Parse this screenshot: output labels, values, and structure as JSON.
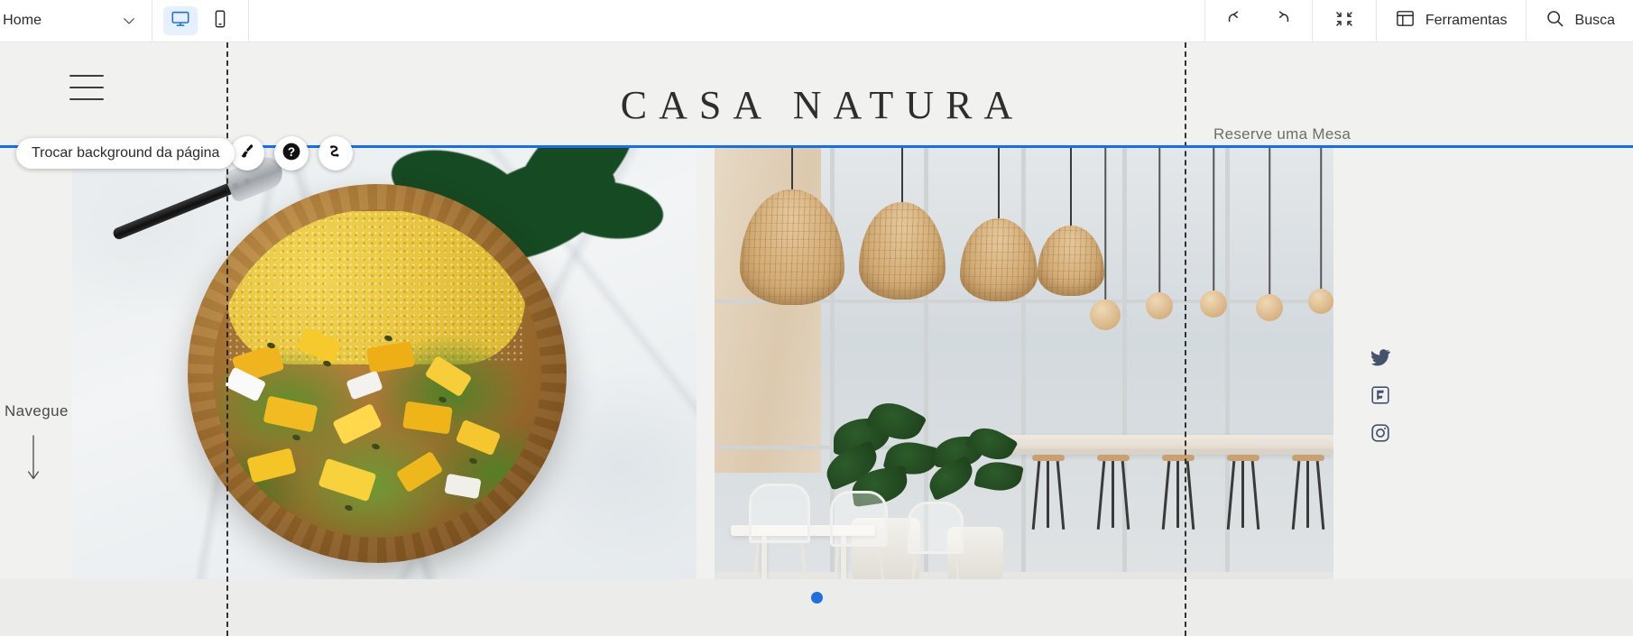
{
  "editor": {
    "page_selector": {
      "label": ": Home",
      "chevron_icon": "chevron-down-icon"
    },
    "devices": [
      {
        "name": "desktop",
        "icon": "monitor-icon",
        "active": true
      },
      {
        "name": "mobile",
        "icon": "smartphone-icon",
        "active": false
      }
    ],
    "actions": [
      {
        "name": "undo",
        "icon": "undo-arrow-icon"
      },
      {
        "name": "redo",
        "icon": "redo-arrow-icon"
      },
      {
        "name": "collapse",
        "icon": "collapse-arrows-icon"
      }
    ],
    "tools_button": {
      "label": "Ferramentas",
      "icon": "panel-layout-icon"
    },
    "search_button": {
      "label": "Busca",
      "icon": "search-icon"
    },
    "tooltip": "Trocar background da página",
    "bubbles": [
      {
        "name": "change-background",
        "icon": "paintbrush-icon"
      },
      {
        "name": "help",
        "icon": "question-mark-icon"
      },
      {
        "name": "animation",
        "icon": "motion-path-icon"
      }
    ],
    "accent_color": "#156df7",
    "guide_color": "#1f1f1f"
  },
  "site": {
    "menu_icon": "hamburger-menu-icon",
    "title": "CASA NATURA",
    "reserve_link": "Reserve uma Mesa",
    "scroll_hint": {
      "label": "Navegue",
      "icon": "arrow-down-icon"
    },
    "socials": [
      {
        "name": "twitter",
        "icon": "twitter-bird-icon"
      },
      {
        "name": "foursquare",
        "icon": "foursquare-icon"
      },
      {
        "name": "instagram",
        "icon": "instagram-icon"
      }
    ],
    "gallery": {
      "slides": [
        {
          "name": "salad-bowl-photo",
          "alt": "Tigela de madeira com cuscuz, couve e legumes amarelos"
        },
        {
          "name": "restaurant-interior-photo",
          "alt": "Interior do restaurante com luminárias de vime"
        }
      ],
      "active_dot_index": 0
    },
    "background_color": "#f1f1ef"
  }
}
